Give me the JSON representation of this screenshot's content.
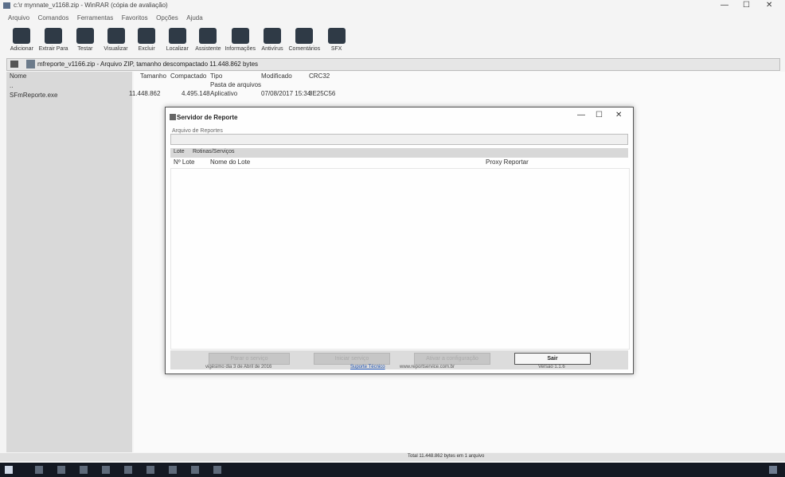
{
  "window": {
    "title": "c:\\r mynnate_v1168.zip - WinRAR (cópia de avaliação)",
    "controls": [
      "—",
      "☐",
      "✕"
    ]
  },
  "menu": [
    "Arquivo",
    "Comandos",
    "Ferramentas",
    "Favoritos",
    "Opções",
    "Ajuda"
  ],
  "toolbar": [
    {
      "label": "Adicionar",
      "icon": "add-icon"
    },
    {
      "label": "Extrair Para",
      "icon": "extract-icon"
    },
    {
      "label": "Testar",
      "icon": "test-icon"
    },
    {
      "label": "Visualizar",
      "icon": "view-icon"
    },
    {
      "label": "Excluir",
      "icon": "delete-icon"
    },
    {
      "label": "Localizar",
      "icon": "find-icon"
    },
    {
      "label": "Assistente",
      "icon": "wizard-icon"
    },
    {
      "label": "Informações",
      "icon": "info-icon"
    },
    {
      "label": "Antivírus",
      "icon": "antivirus-icon"
    },
    {
      "label": "Comentários",
      "icon": "comment-icon"
    },
    {
      "label": "SFX",
      "icon": "sfx-icon"
    }
  ],
  "address": {
    "text": "mfreporte_v1166.zip - Arquivo ZIP, tamanho descompactado 11.448.862 bytes"
  },
  "tree": {
    "header": "Nome",
    "items": [
      "..",
      "SFmReporte.exe"
    ]
  },
  "columns": {
    "name": "Nome",
    "size": "Tamanho",
    "packed": "Compactado",
    "type": "Tipo",
    "modified": "Modificado",
    "crc": "CRC32"
  },
  "rows": [
    {
      "size": "",
      "packed": "",
      "type": "Pasta de arquivos",
      "modified": "",
      "crc": ""
    },
    {
      "size": "11.448.862",
      "packed": "4.495.148",
      "type": "Aplicativo",
      "modified": "07/08/2017 15:34",
      "crc": "8E25C56"
    }
  ],
  "dialog": {
    "title": "Servidor de Reporte",
    "controls": [
      "—",
      "☐",
      "✕"
    ],
    "archive_label": "Arquivo de Reportes",
    "tabs": [
      "Lote",
      "Rotinas/Serviços"
    ],
    "list_headers": {
      "id": "Nº Lote",
      "name": "Nome do Lote",
      "process": "Proxy Reportar"
    },
    "buttons": [
      {
        "label": "Parar o serviço",
        "enabled": false
      },
      {
        "label": "Iniciar serviço",
        "enabled": false
      },
      {
        "label": "Ativar a configuração",
        "enabled": false
      },
      {
        "label": "Sair",
        "enabled": true
      }
    ],
    "footer_left": "vigésimo dia 3 de Abril de 2016",
    "footer_link": "Suporte Técnico",
    "footer_site": "www.reportservice.com.br",
    "footer_version": "Versão 1.1.6"
  },
  "status": {
    "left": "",
    "mid": "Total 11.448.862 bytes em 1 arquivo"
  },
  "taskbar": {
    "icons": [
      "start-icon",
      "search-icon",
      "taskview-icon",
      "edge-icon",
      "explorer-icon",
      "store-icon",
      "mail-icon",
      "app1-icon",
      "app2-icon",
      "app3-icon"
    ]
  }
}
